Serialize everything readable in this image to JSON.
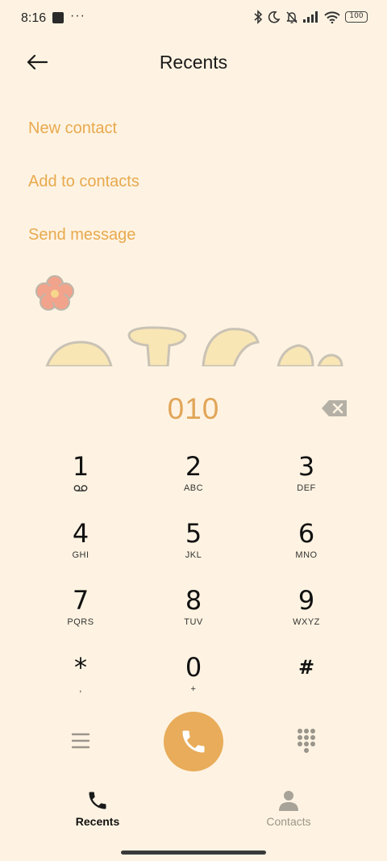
{
  "status_bar": {
    "time": "8:16",
    "dots": "···",
    "battery": "100",
    "icons": [
      "notification-square-icon",
      "bluetooth-icon",
      "moon-icon",
      "bell-off-icon",
      "signal-icon",
      "wifi-icon",
      "battery-icon"
    ]
  },
  "header": {
    "title": "Recents",
    "back_icon": "back-arrow-icon"
  },
  "actions": {
    "new_contact": "New contact",
    "add_to_contacts": "Add to contacts",
    "send_message": "Send message"
  },
  "dialer": {
    "number": "010",
    "keys": [
      {
        "digit": "1",
        "letters": ""
      },
      {
        "digit": "2",
        "letters": "ABC"
      },
      {
        "digit": "3",
        "letters": "DEF"
      },
      {
        "digit": "4",
        "letters": "GHI"
      },
      {
        "digit": "5",
        "letters": "JKL"
      },
      {
        "digit": "6",
        "letters": "MNO"
      },
      {
        "digit": "7",
        "letters": "PQRS"
      },
      {
        "digit": "8",
        "letters": "TUV"
      },
      {
        "digit": "9",
        "letters": "WXYZ"
      },
      {
        "digit": "*",
        "letters": ","
      },
      {
        "digit": "0",
        "letters": "+"
      },
      {
        "digit": "#",
        "letters": ""
      }
    ]
  },
  "tabs": [
    {
      "label": "Recents",
      "icon": "phone-icon",
      "active": true
    },
    {
      "label": "Contacts",
      "icon": "person-icon",
      "active": false
    }
  ],
  "colors": {
    "background": "#FEF3E2",
    "accent": "#E8A94E",
    "call_button": "#E8AC5A",
    "dial_number": "#E1A558"
  }
}
